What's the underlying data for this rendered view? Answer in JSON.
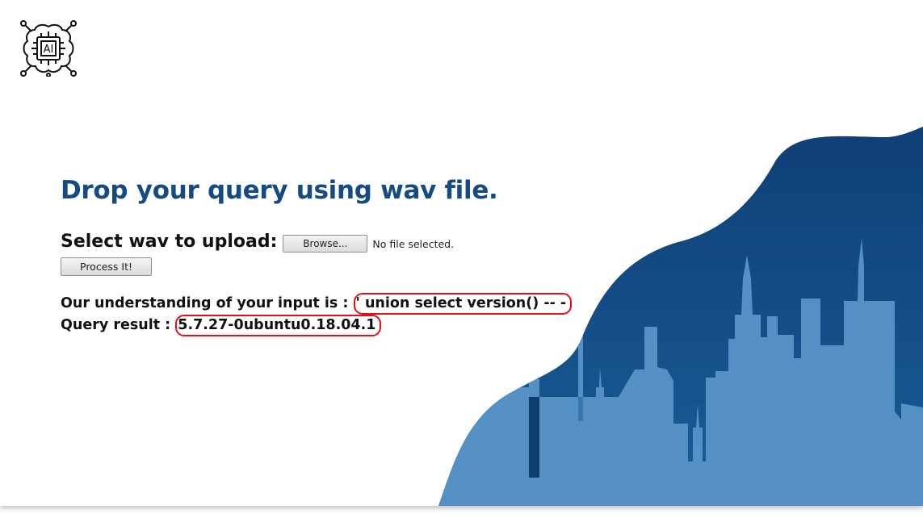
{
  "logo": {
    "text": "AI",
    "icon": "ai-chip-brain-icon"
  },
  "colors": {
    "title": "#154a82",
    "wave_dark": "#124780",
    "wave_light": "#5490c4",
    "highlight": "#e0101a"
  },
  "main": {
    "title": "Drop your query using wav file.",
    "upload_label": "Select wav to upload:",
    "browse_label": "Browse...",
    "file_status": "No file selected.",
    "process_label": "Process It!",
    "understanding_label": "Our understanding of your input is :",
    "understanding_value": "' union select version() -- -",
    "result_label": "Query result :",
    "result_value": "5.7.27-0ubuntu0.18.04.1"
  }
}
